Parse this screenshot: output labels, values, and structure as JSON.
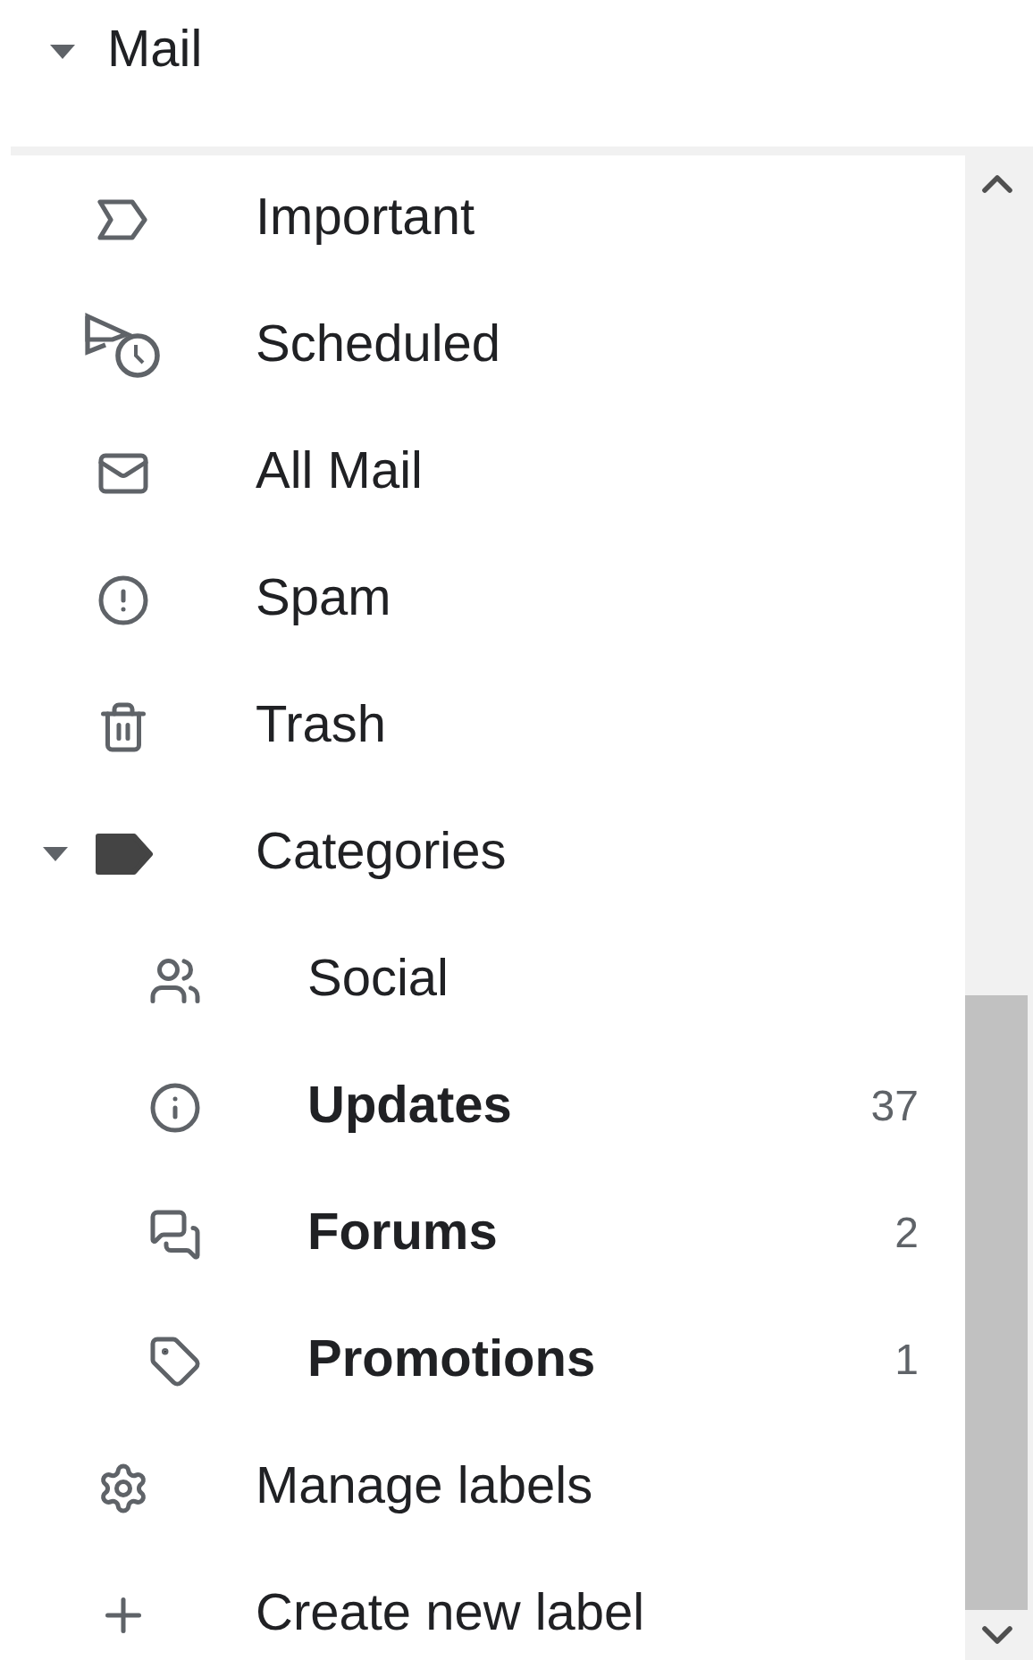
{
  "header": {
    "label": "Mail",
    "expanded": true
  },
  "items": [
    {
      "label": "Important"
    },
    {
      "label": "Scheduled"
    },
    {
      "label": "All Mail"
    },
    {
      "label": "Spam"
    },
    {
      "label": "Trash"
    },
    {
      "label": "Categories",
      "expanded": true,
      "children": [
        {
          "label": "Social",
          "unread": false
        },
        {
          "label": "Updates",
          "unread": true,
          "count": "37"
        },
        {
          "label": "Forums",
          "unread": true,
          "count": "2"
        },
        {
          "label": "Promotions",
          "unread": true,
          "count": "1"
        }
      ]
    },
    {
      "label": "Manage labels"
    },
    {
      "label": "Create new label"
    }
  ]
}
